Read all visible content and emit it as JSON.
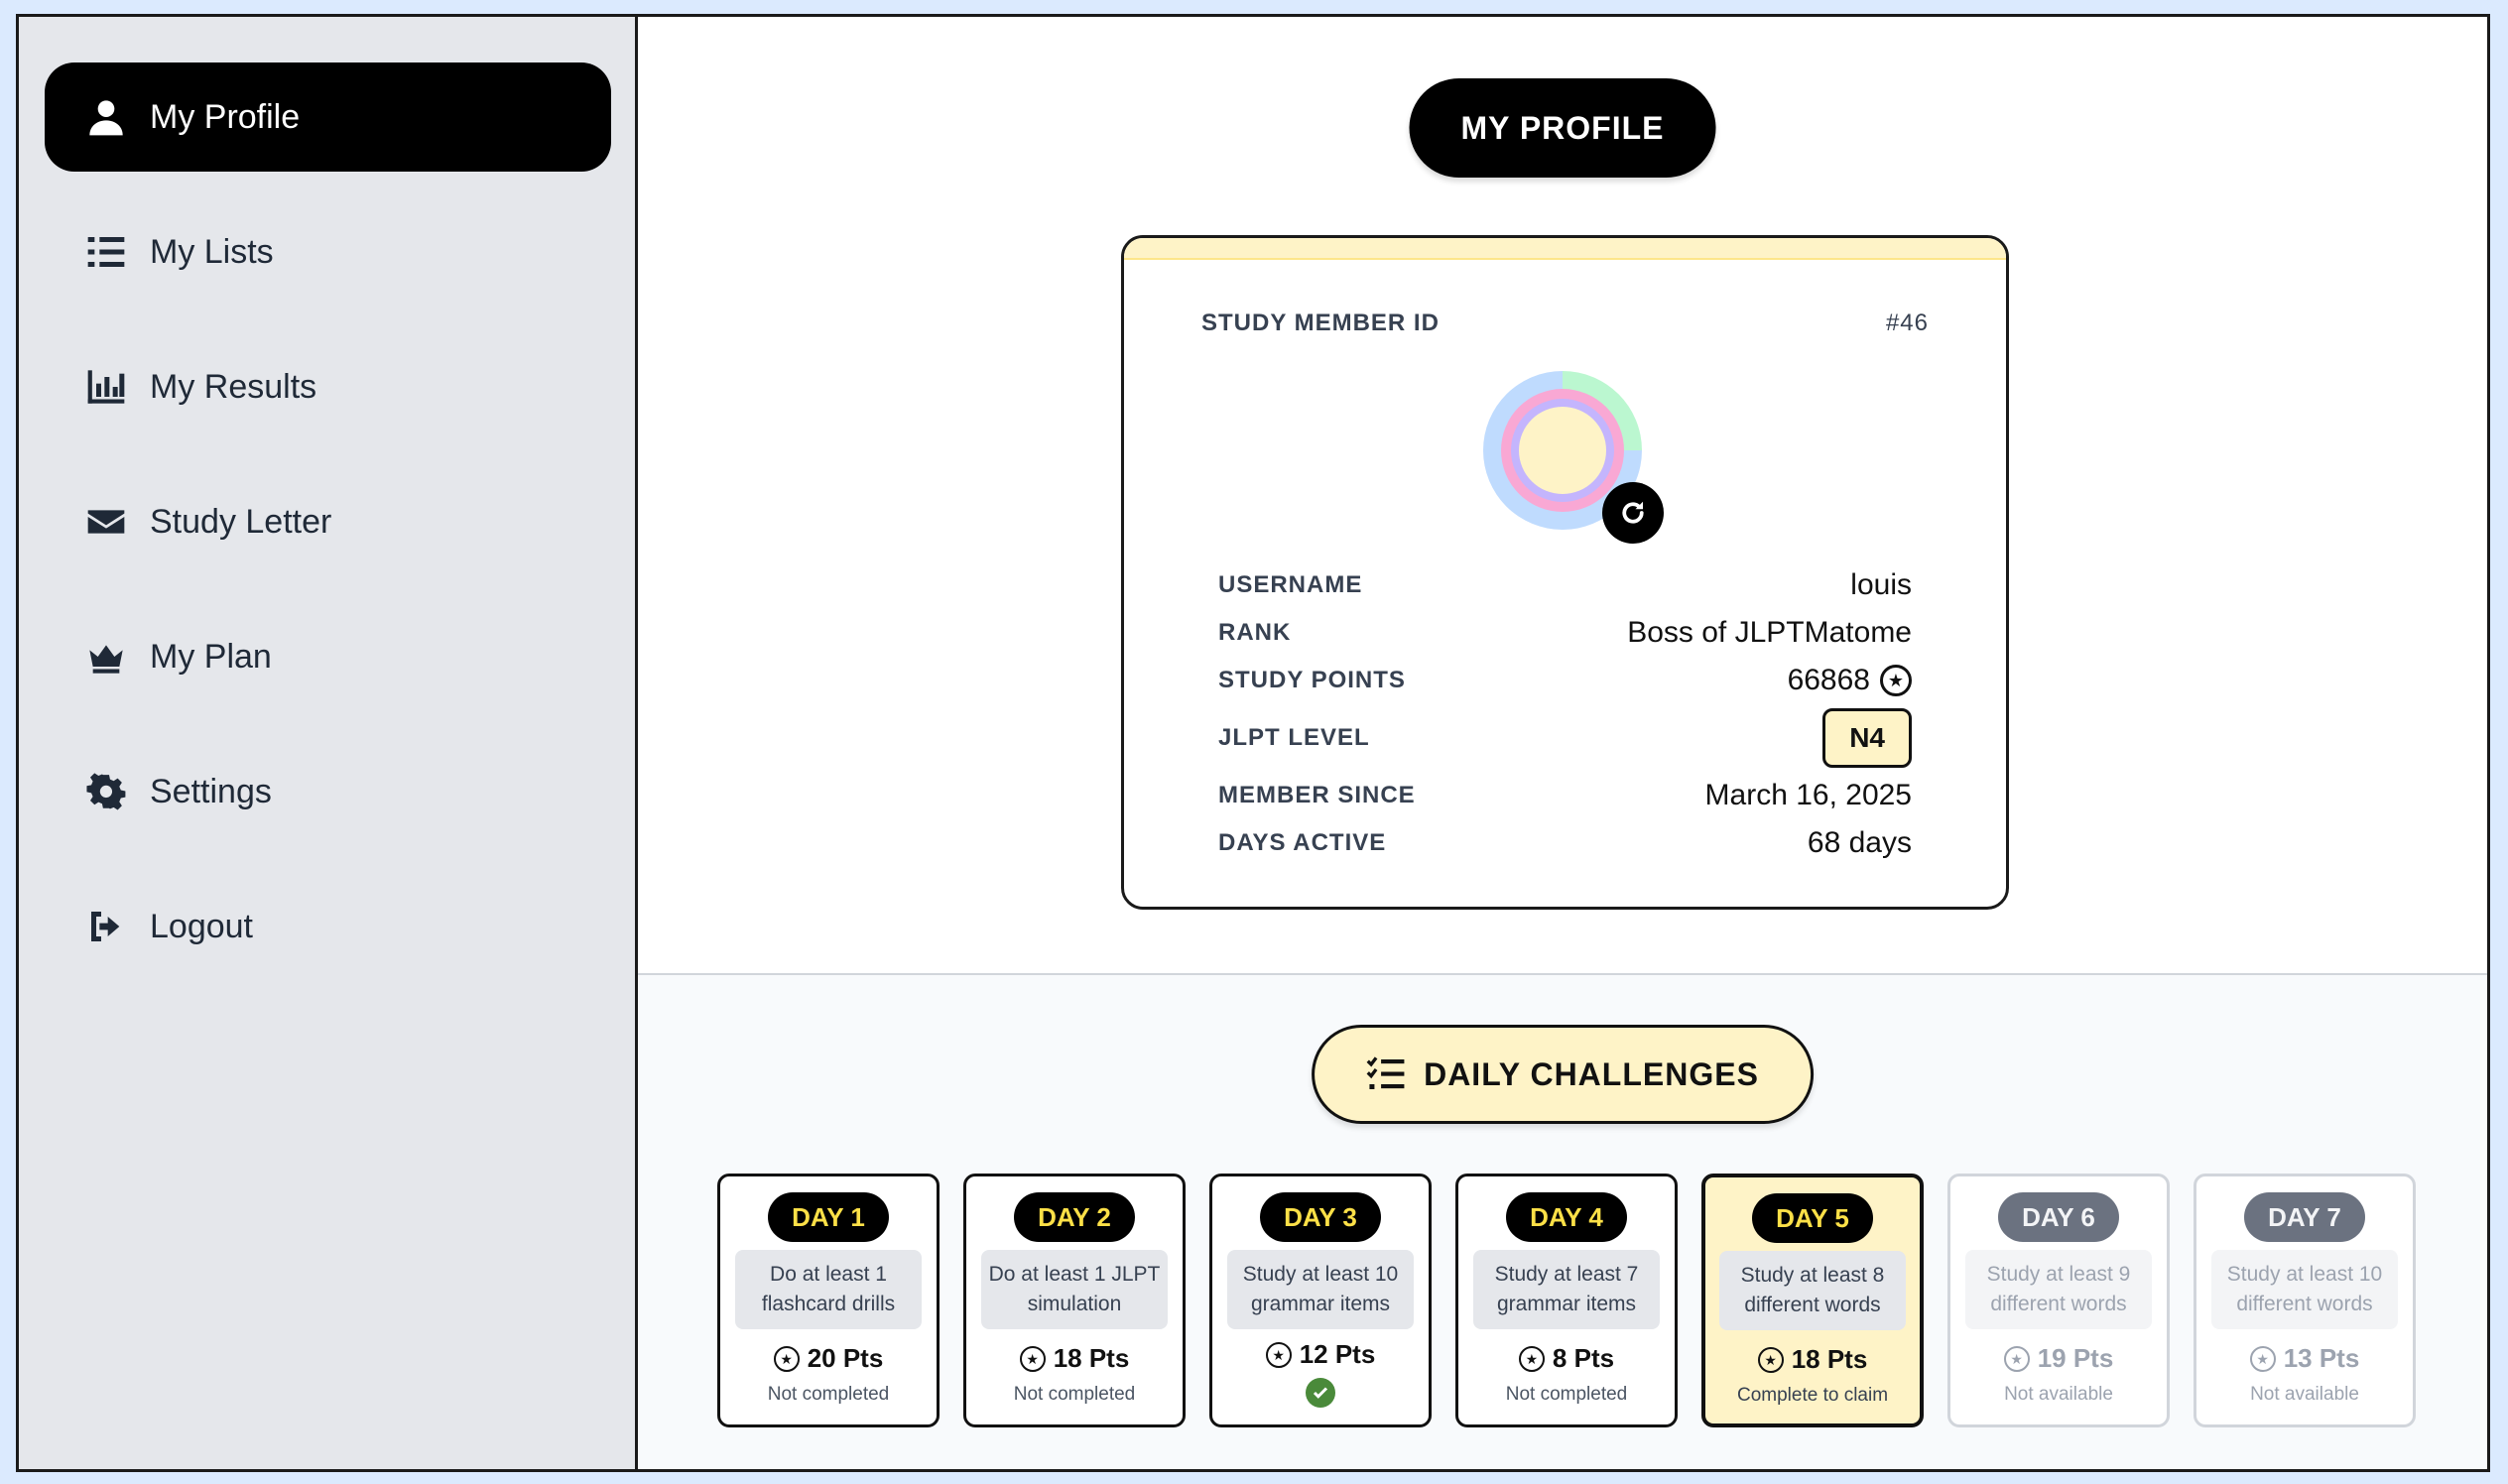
{
  "sidebar": {
    "items": [
      {
        "label": "My Profile",
        "icon": "user-icon"
      },
      {
        "label": "My Lists",
        "icon": "list-icon"
      },
      {
        "label": "My Results",
        "icon": "bar-chart-icon"
      },
      {
        "label": "Study Letter",
        "icon": "envelope-icon"
      },
      {
        "label": "My Plan",
        "icon": "crown-icon"
      },
      {
        "label": "Settings",
        "icon": "gear-icon"
      },
      {
        "label": "Logout",
        "icon": "logout-icon"
      }
    ]
  },
  "profile": {
    "title": "MY PROFILE",
    "member_id_label": "STUDY MEMBER ID",
    "member_id": "#46",
    "rows": {
      "username_label": "USERNAME",
      "username": "louis",
      "rank_label": "RANK",
      "rank": "Boss of JLPTMatome",
      "points_label": "STUDY POINTS",
      "points": "66868",
      "level_label": "JLPT LEVEL",
      "level": "N4",
      "since_label": "MEMBER SINCE",
      "since": "March 16, 2025",
      "active_label": "DAYS ACTIVE",
      "active": "68 days"
    },
    "star_glyph": "★"
  },
  "challenges": {
    "title": "DAILY CHALLENGES",
    "days": [
      {
        "label": "DAY 1",
        "desc": "Do at least 1 flashcard drills",
        "pts": "20 Pts",
        "status": "Not completed"
      },
      {
        "label": "DAY 2",
        "desc": "Do at least 1 JLPT simulation",
        "pts": "18 Pts",
        "status": "Not completed"
      },
      {
        "label": "DAY 3",
        "desc": "Study at least 10 grammar items",
        "pts": "12 Pts",
        "status": ""
      },
      {
        "label": "DAY 4",
        "desc": "Study at least 7 grammar items",
        "pts": "8 Pts",
        "status": "Not completed"
      },
      {
        "label": "DAY 5",
        "desc": "Study at least 8 different words",
        "pts": "18 Pts",
        "status": "Complete to claim"
      },
      {
        "label": "DAY 6",
        "desc": "Study at least 9 different words",
        "pts": "19 Pts",
        "status": "Not available"
      },
      {
        "label": "DAY 7",
        "desc": "Study at least 10 different words",
        "pts": "13 Pts",
        "status": "Not available"
      }
    ]
  },
  "colors": {
    "accent": "#fef3c7",
    "badge_text": "#fde047",
    "check": "#4a8a3a"
  }
}
